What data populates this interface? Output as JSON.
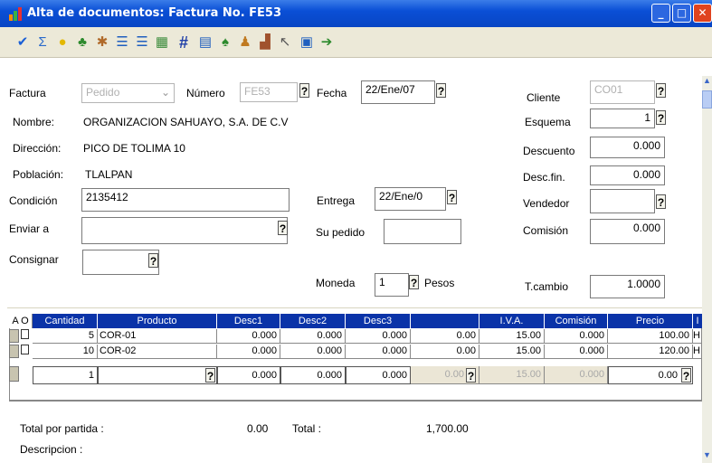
{
  "window": {
    "title": "Alta de documentos: Factura No. FE53",
    "min": "_",
    "max": "□",
    "close": "✕"
  },
  "toolbar_icons": [
    "check-icon",
    "sigma-icon",
    "bulb-icon",
    "people-icon",
    "tools-icon",
    "lines-icon",
    "lines-icon",
    "grid-icon",
    "hash-icon",
    "doc-icon",
    "tree-icon",
    "person-icon",
    "graph-icon",
    "pointer-icon",
    "calc-icon",
    "arrow-icon"
  ],
  "form": {
    "factura_label": "Factura",
    "tipo_value": "Pedido",
    "numero_label": "Número",
    "numero_value": "FE53",
    "fecha_label": "Fecha",
    "fecha_value": "22/Ene/07",
    "cliente_label": "Cliente",
    "cliente_value": "CO01",
    "nombre_label": "Nombre:",
    "nombre_value": "ORGANIZACION SAHUAYO, S.A. DE C.V",
    "esquema_label": "Esquema",
    "esquema_value": "1",
    "direccion_label": "Dirección:",
    "direccion_value": "PICO DE TOLIMA 10",
    "descuento_label": "Descuento",
    "descuento_value": "0.000",
    "poblacion_label": "Población:",
    "poblacion_value": "TLALPAN",
    "descfin_label": "Desc.fin.",
    "descfin_value": "0.000",
    "condicion_label": "Condición",
    "condicion_value": "2135412",
    "entrega_label": "Entrega",
    "entrega_value": "22/Ene/0",
    "vendedor_label": "Vendedor",
    "vendedor_value": "",
    "enviar_label": "Enviar a",
    "enviar_value": "",
    "supedido_label": "Su pedido",
    "supedido_value": "",
    "comision_label": "Comisión",
    "comision_value": "0.000",
    "consignar_label": "Consignar",
    "consignar_value": "",
    "moneda_label": "Moneda",
    "moneda_value": "1",
    "moneda_name": "Pesos",
    "tcambio_label": "T.cambio",
    "tcambio_value": "1.0000",
    "q": "?"
  },
  "grid": {
    "ao": "A O",
    "headers": [
      "Cantidad",
      "Producto",
      "Desc1",
      "Desc2",
      "Desc3",
      "",
      "I.V.A.",
      "Comisión",
      "Precio",
      "I"
    ],
    "rows": [
      [
        "5",
        "COR-01",
        "0.000",
        "0.000",
        "0.000",
        "0.00",
        "15.00",
        "0.000",
        "100.00",
        "H"
      ],
      [
        "10",
        "COR-02",
        "0.000",
        "0.000",
        "0.000",
        "0.00",
        "15.00",
        "0.000",
        "120.00",
        "H"
      ],
      [
        "1",
        "",
        "0.000",
        "0.000",
        "0.000",
        "0.00",
        "15.00",
        "0.000",
        "0.00",
        ""
      ]
    ]
  },
  "footer": {
    "total_partida_label": "Total por partida :",
    "total_partida_value": "0.00",
    "total_label": "Total :",
    "total_value": "1,700.00",
    "descripcion_label": "Descripcion :"
  }
}
